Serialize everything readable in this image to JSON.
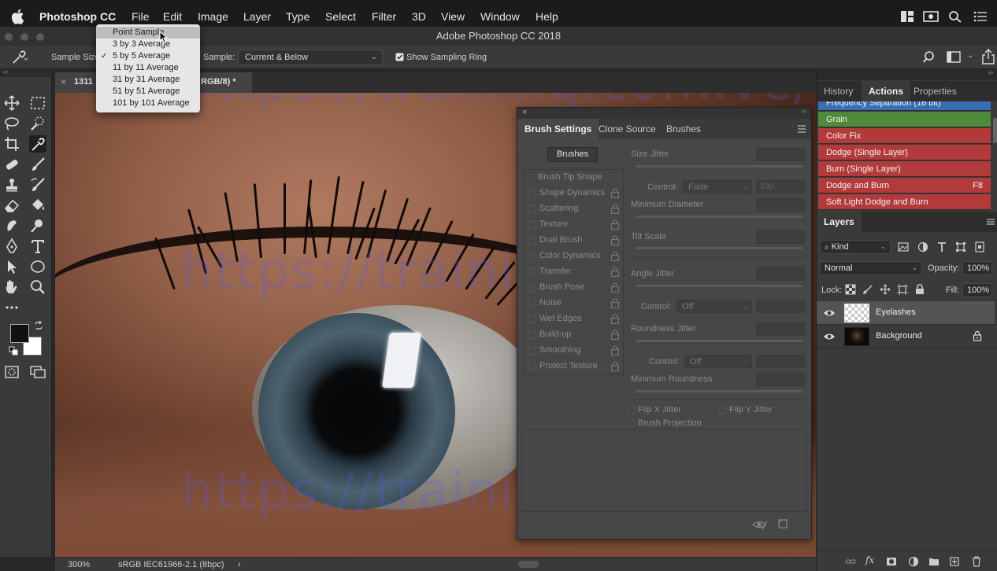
{
  "menubar": {
    "app_name": "Photoshop CC",
    "items": [
      "File",
      "Edit",
      "Image",
      "Layer",
      "Type",
      "Select",
      "Filter",
      "3D",
      "View",
      "Window",
      "Help"
    ]
  },
  "window": {
    "title": "Adobe Photoshop CC 2018"
  },
  "options": {
    "sample_size_label": "Sample Size",
    "sample_label": "Sample:",
    "sample_value": "Current & Below",
    "show_sampling_ring_label": "Show Sampling Ring",
    "show_sampling_ring_checked": true
  },
  "sample_menu": {
    "items": [
      {
        "label": "Point Sample",
        "checked": false,
        "highlighted": true
      },
      {
        "label": "3 by 3 Average",
        "checked": false,
        "highlighted": false
      },
      {
        "label": "5 by 5 Average",
        "checked": true,
        "highlighted": false
      },
      {
        "label": "11 by 11 Average",
        "checked": false,
        "highlighted": false
      },
      {
        "label": "31 by 31 Average",
        "checked": false,
        "highlighted": false
      },
      {
        "label": "51 by 51 Average",
        "checked": false,
        "highlighted": false
      },
      {
        "label": "101 by 101 Average",
        "checked": false,
        "highlighted": false
      }
    ]
  },
  "document_tab": {
    "title_left": "1311",
    "title_right": "RGB/8) *"
  },
  "status": {
    "zoom": "300%",
    "profile": "sRGB IEC61966-2.1 (8bpc)",
    "arrow": "›"
  },
  "watermark": "https://training.com.ve/",
  "brush_panel": {
    "tabs": [
      "Brush Settings",
      "Clone Source",
      "Brushes"
    ],
    "active_tab": 0,
    "brushes_button": "Brushes",
    "options": [
      "Brush Tip Shape",
      "Shape Dynamics",
      "Scattering",
      "Texture",
      "Dual Brush",
      "Color Dynamics",
      "Transfer",
      "Brush Pose",
      "Noise",
      "Wet Edges",
      "Build-up",
      "Smoothing",
      "Protect Texture"
    ],
    "right": {
      "size_jitter": "Size Jitter",
      "control_label": "Control:",
      "control1_value": "Fade",
      "control1_number": "100",
      "minimum_diameter": "Minimum Diameter",
      "tilt_scale": "Tilt Scale",
      "angle_jitter": "Angle Jitter",
      "control2_value": "Off",
      "roundness_jitter": "Roundness Jitter",
      "control3_value": "Off",
      "minimum_roundness": "Minimum Roundness",
      "flip_x": "Flip X Jitter",
      "flip_y": "Flip Y Jitter",
      "brush_projection": "Brush Projection"
    }
  },
  "actions_panel": {
    "tabs": [
      "History",
      "Actions",
      "Properties"
    ],
    "active_tab": 1,
    "items": [
      {
        "label": "Frequency Separation (16 bit)",
        "color": "#3b6db5",
        "shortcut": ""
      },
      {
        "label": "Grain",
        "color": "#4e8a3a",
        "shortcut": ""
      },
      {
        "label": "Color Fix",
        "color": "#b33a3a",
        "shortcut": ""
      },
      {
        "label": "Dodge (Single Layer)",
        "color": "#b33a3a",
        "shortcut": ""
      },
      {
        "label": "Burn (Single Layer)",
        "color": "#b33a3a",
        "shortcut": ""
      },
      {
        "label": "Dodge and Burn",
        "color": "#b33a3a",
        "shortcut": "F8"
      },
      {
        "label": "Soft Light Dodge and Burn",
        "color": "#b33a3a",
        "shortcut": ""
      }
    ]
  },
  "layers_panel": {
    "tab": "Layers",
    "kind_label": "Kind",
    "blend_mode": "Normal",
    "opacity_label": "Opacity:",
    "opacity_value": "100%",
    "lock_label": "Lock:",
    "fill_label": "Fill:",
    "fill_value": "100%",
    "layers": [
      {
        "name": "Eyelashes",
        "selected": true,
        "locked": false
      },
      {
        "name": "Background",
        "selected": false,
        "locked": true
      }
    ]
  }
}
